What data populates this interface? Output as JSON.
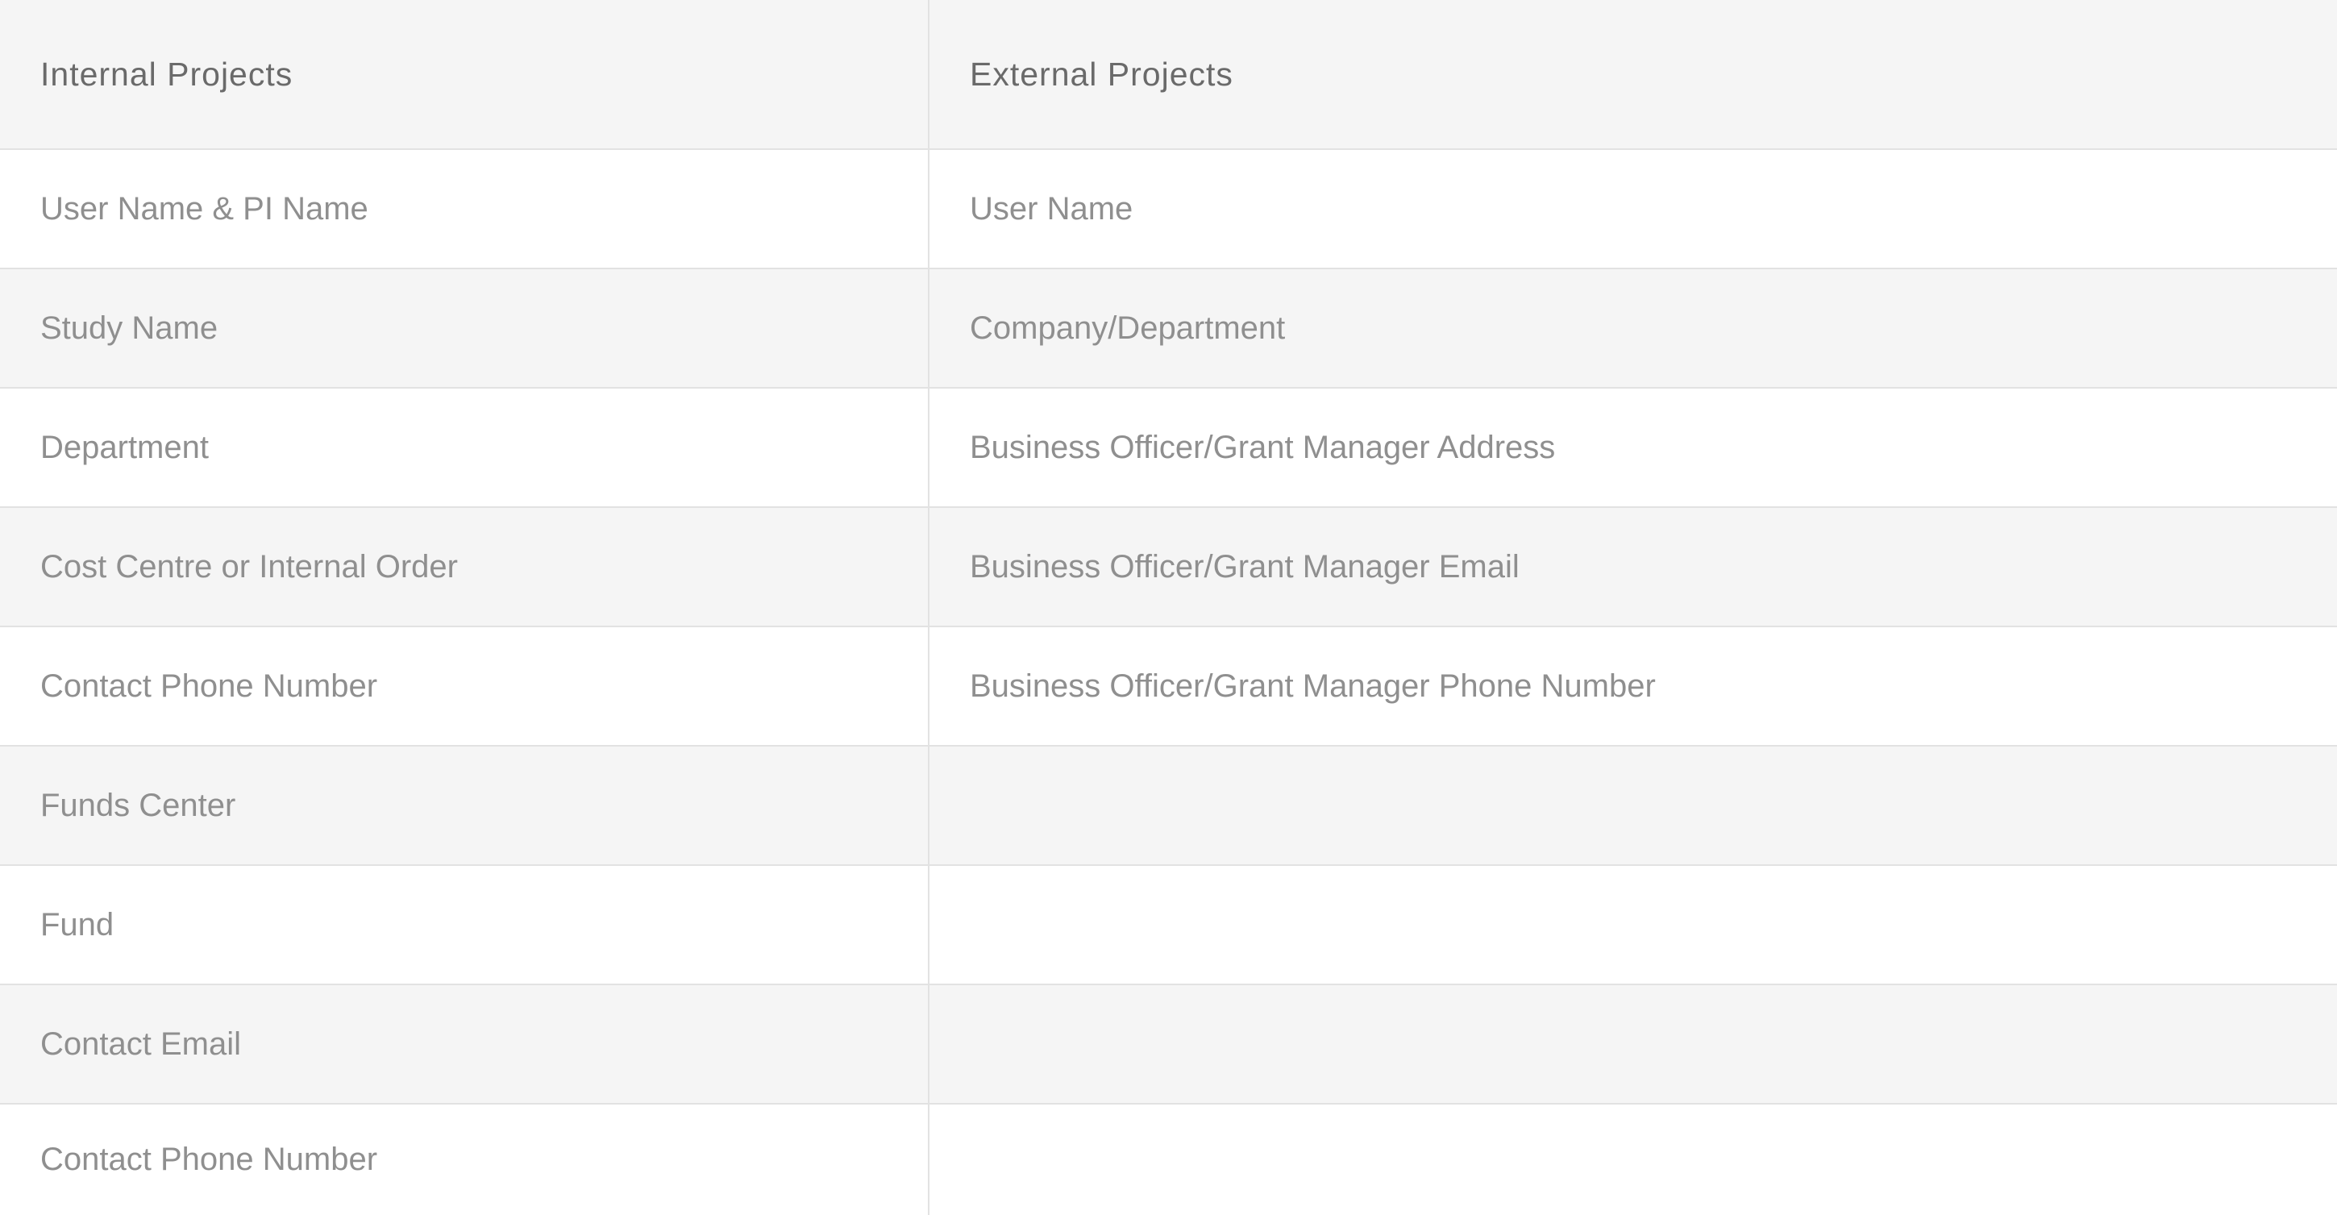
{
  "table": {
    "headers": {
      "internal": "Internal Projects",
      "external": "External Projects"
    },
    "rows": [
      {
        "internal": "User Name & PI Name",
        "external": "User Name"
      },
      {
        "internal": "Study Name",
        "external": "Company/Department"
      },
      {
        "internal": "Department",
        "external": "Business Officer/Grant Manager Address"
      },
      {
        "internal": "Cost Centre or Internal Order",
        "external": "Business Officer/Grant Manager Email"
      },
      {
        "internal": "Contact Phone Number",
        "external": "Business Officer/Grant Manager Phone Number"
      },
      {
        "internal": "Funds Center",
        "external": ""
      },
      {
        "internal": "Fund",
        "external": ""
      },
      {
        "internal": "Contact Email",
        "external": ""
      },
      {
        "internal": "Contact Phone Number",
        "external": ""
      }
    ]
  }
}
